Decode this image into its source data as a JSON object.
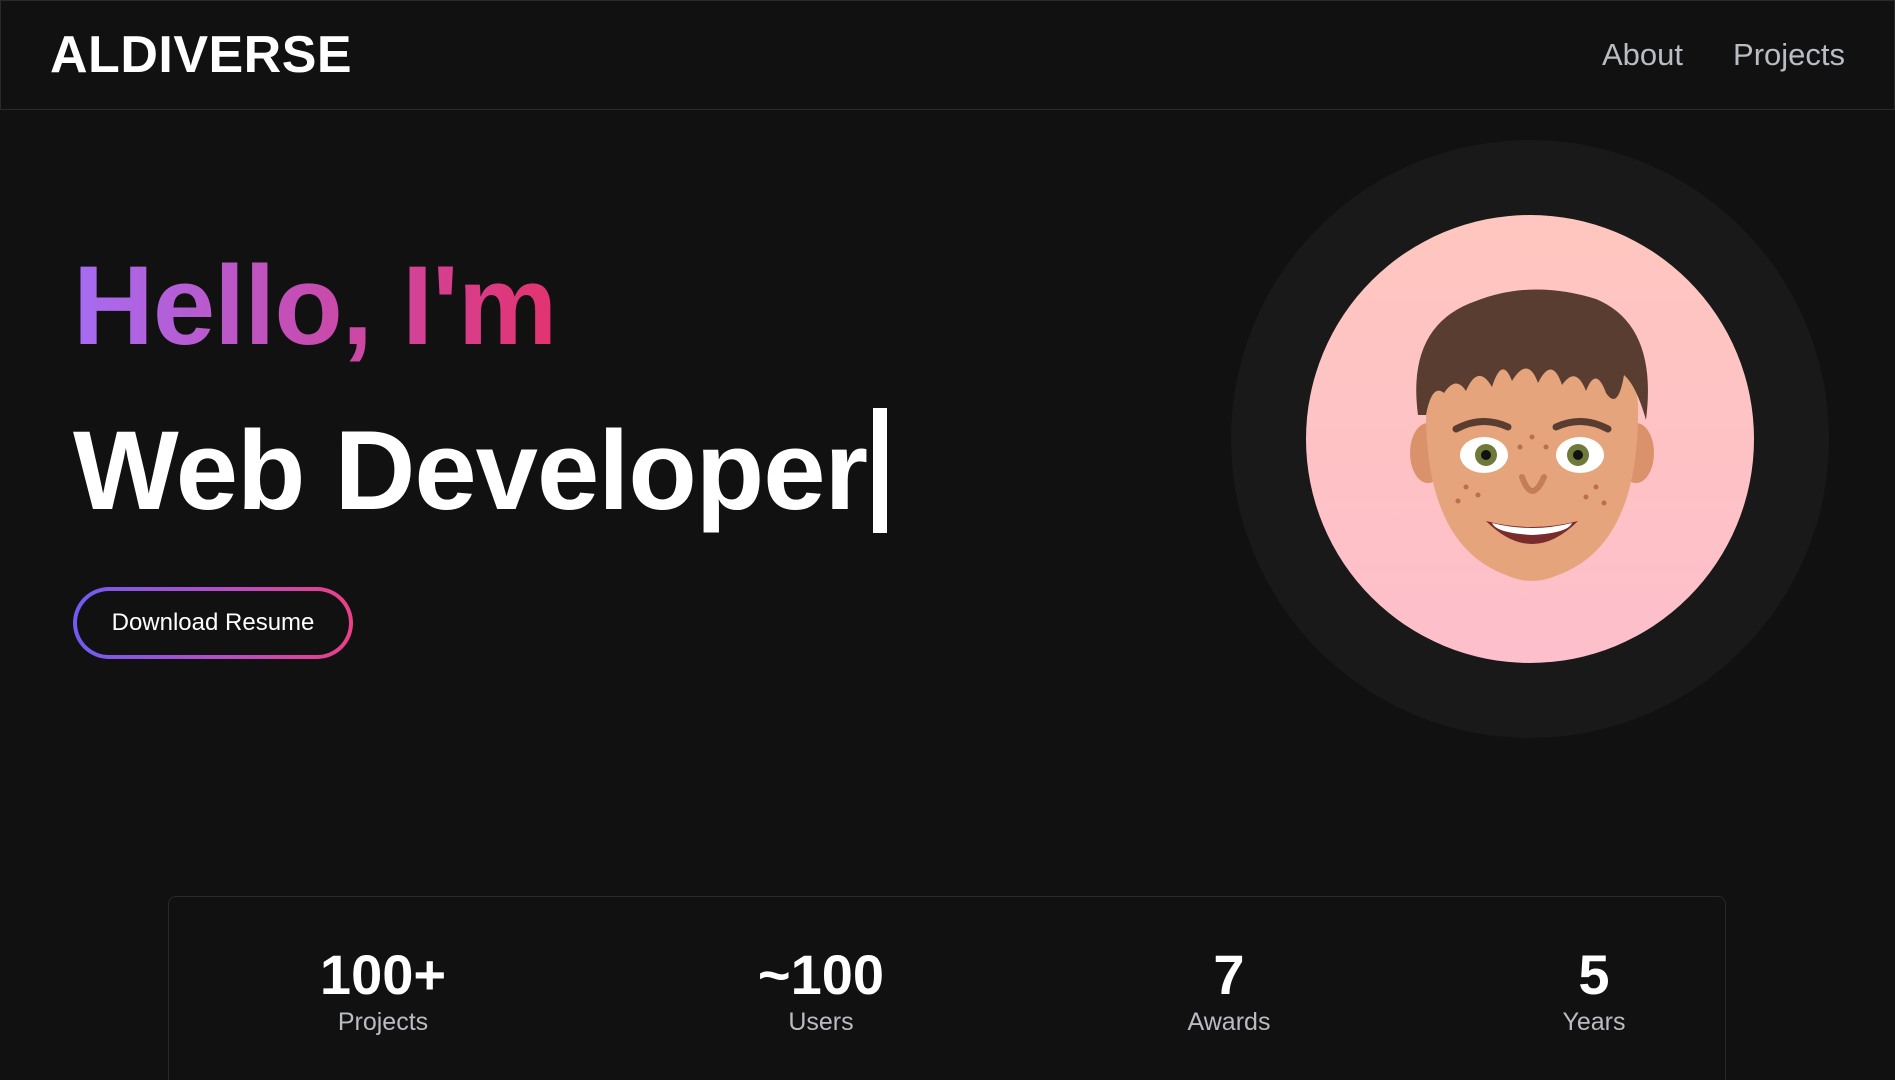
{
  "header": {
    "logo": "ALDIVERSE",
    "nav": [
      {
        "label": "About"
      },
      {
        "label": "Projects"
      }
    ]
  },
  "hero": {
    "greeting": "Hello, I'm",
    "role": "Web Developer",
    "resume_button": "Download Resume",
    "gradient_colors": [
      "#a66cf3",
      "#c44fb6",
      "#e3336f"
    ]
  },
  "avatar": {
    "icon": "memoji-avatar",
    "background": "#fdc3c5"
  },
  "stats": [
    {
      "value": "100+",
      "label": "Projects"
    },
    {
      "value": "~100",
      "label": "Users"
    },
    {
      "value": "7",
      "label": "Awards"
    },
    {
      "value": "5",
      "label": "Years"
    }
  ]
}
